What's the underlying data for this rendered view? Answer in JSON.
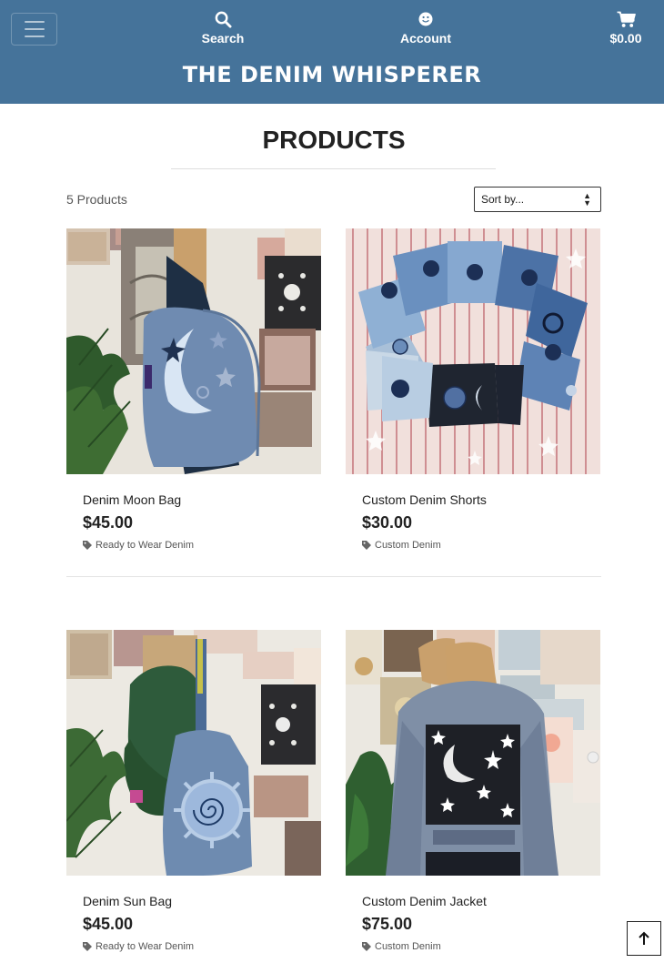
{
  "nav": {
    "toggle_icon": "hamburger-icon",
    "search": {
      "label": "Search",
      "icon": "search-icon"
    },
    "account": {
      "label": "Account",
      "icon": "smiley-icon"
    },
    "cart": {
      "label": "$0.00",
      "icon": "cart-icon"
    },
    "brand": "THE DENIM WHISPERER",
    "background_color": "#45739a"
  },
  "page": {
    "title": "PRODUCTS",
    "count": "5 Products",
    "sort": {
      "selected": "Sort by..."
    }
  },
  "products": [
    {
      "name": "Denim Moon Bag",
      "price": "$45.00",
      "category": "Ready to Wear Denim",
      "image": "denim-moon-bag-photo"
    },
    {
      "name": "Custom Denim Shorts",
      "price": "$30.00",
      "category": "Custom Denim",
      "image": "custom-denim-shorts-photo"
    },
    {
      "name": "Denim Sun Bag",
      "price": "$45.00",
      "category": "Ready to Wear Denim",
      "image": "denim-sun-bag-photo"
    },
    {
      "name": "Custom Denim Jacket",
      "price": "$75.00",
      "category": "Custom Denim",
      "image": "custom-denim-jacket-photo"
    }
  ],
  "back_to_top_icon": "arrow-up-icon"
}
